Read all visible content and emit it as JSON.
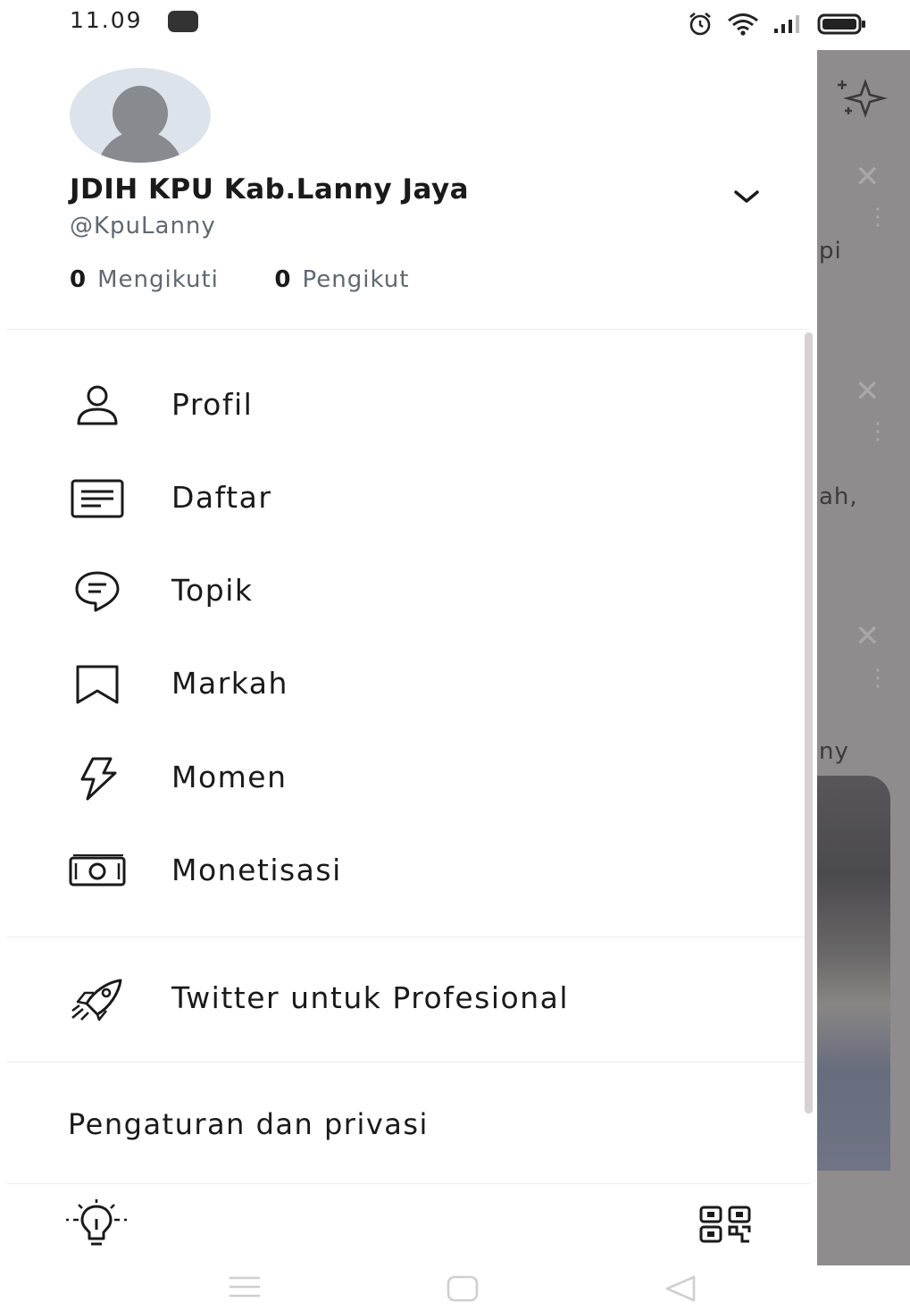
{
  "status_bar": {
    "time": "11.09",
    "icons": [
      "notification-icon",
      "alarm-icon",
      "wifi-icon",
      "signal-icon",
      "battery-icon"
    ]
  },
  "profile": {
    "display_name": "JDIH KPU Kab.Lanny Jaya",
    "handle": "@KpuLanny",
    "following_count": "0",
    "following_label": "Mengikuti",
    "followers_count": "0",
    "followers_label": "Pengikut"
  },
  "menu": {
    "items": [
      {
        "label": "Profil",
        "icon": "person-icon"
      },
      {
        "label": "Daftar",
        "icon": "list-icon"
      },
      {
        "label": "Topik",
        "icon": "topic-icon"
      },
      {
        "label": "Markah",
        "icon": "bookmark-icon"
      },
      {
        "label": "Momen",
        "icon": "lightning-icon"
      },
      {
        "label": "Monetisasi",
        "icon": "money-icon"
      }
    ],
    "professional": {
      "label": "Twitter untuk Profesional",
      "icon": "rocket-icon"
    },
    "settings_label": "Pengaturan dan privasi"
  },
  "footer": {
    "left_icon": "lightbulb-icon",
    "right_icon": "qr-code-icon"
  },
  "background_feed": {
    "snippets": [
      "pi",
      "ah,",
      "ny"
    ]
  },
  "nav_bar": {
    "icons": [
      "recents-icon",
      "home-icon",
      "back-icon"
    ]
  },
  "colors": {
    "text": "#0f1419",
    "secondary": "#606870",
    "overlay": "#8e8c8d"
  }
}
